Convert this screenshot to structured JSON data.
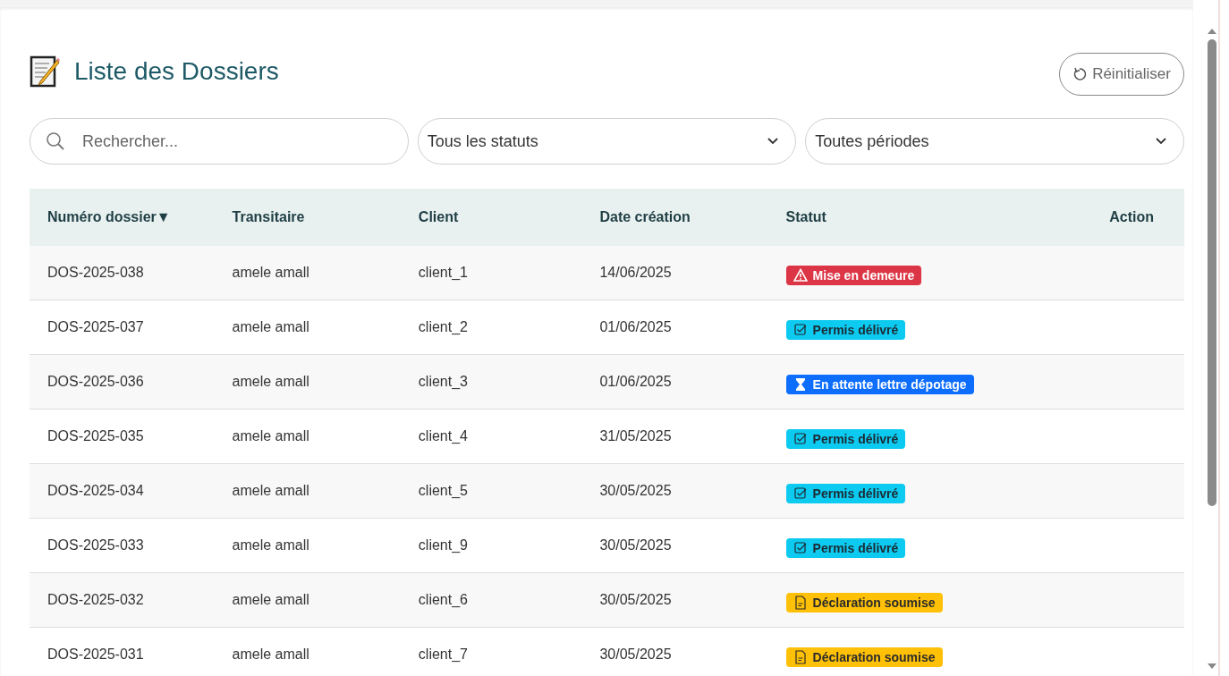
{
  "title": "Liste des Dossiers",
  "reset_button": "Réinitialiser",
  "filters": {
    "search": {
      "placeholder": "Rechercher..."
    },
    "status": "Tous les statuts",
    "period": "Toutes périodes"
  },
  "table": {
    "columns": [
      {
        "label": "Numéro dossier",
        "sort": "▼"
      },
      {
        "label": "Transitaire"
      },
      {
        "label": "Client"
      },
      {
        "label": "Date création"
      },
      {
        "label": "Statut"
      },
      {
        "label": "Action"
      }
    ],
    "rows": [
      {
        "numero": "DOS-2025-038",
        "transitaire": "amele amall",
        "client": "client_1",
        "date": "14/06/2025",
        "status": {
          "label": "Mise en demeure",
          "kind": "danger"
        }
      },
      {
        "numero": "DOS-2025-037",
        "transitaire": "amele amall",
        "client": "client_2",
        "date": "01/06/2025",
        "status": {
          "label": "Permis délivré",
          "kind": "info"
        }
      },
      {
        "numero": "DOS-2025-036",
        "transitaire": "amele amall",
        "client": "client_3",
        "date": "01/06/2025",
        "status": {
          "label": "En attente lettre dépotage",
          "kind": "primary"
        }
      },
      {
        "numero": "DOS-2025-035",
        "transitaire": "amele amall",
        "client": "client_4",
        "date": "31/05/2025",
        "status": {
          "label": "Permis délivré",
          "kind": "info"
        }
      },
      {
        "numero": "DOS-2025-034",
        "transitaire": "amele amall",
        "client": "client_5",
        "date": "30/05/2025",
        "status": {
          "label": "Permis délivré",
          "kind": "info"
        }
      },
      {
        "numero": "DOS-2025-033",
        "transitaire": "amele amall",
        "client": "client_9",
        "date": "30/05/2025",
        "status": {
          "label": "Permis délivré",
          "kind": "info"
        }
      },
      {
        "numero": "DOS-2025-032",
        "transitaire": "amele amall",
        "client": "client_6",
        "date": "30/05/2025",
        "status": {
          "label": "Déclaration soumise",
          "kind": "warning"
        }
      },
      {
        "numero": "DOS-2025-031",
        "transitaire": "amele amall",
        "client": "client_7",
        "date": "30/05/2025",
        "status": {
          "label": "Déclaration soumise",
          "kind": "warning"
        }
      }
    ]
  }
}
